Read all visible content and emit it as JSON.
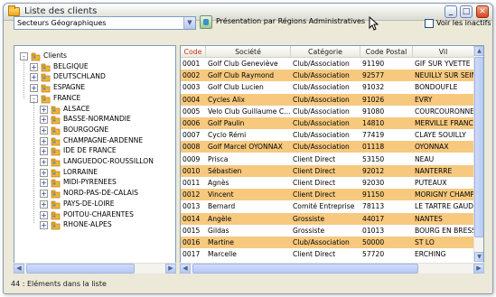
{
  "window": {
    "title": "Liste des clients",
    "minimize_icon": "minimize-icon",
    "maximize_icon": "maximize-icon",
    "close_icon": "close-icon"
  },
  "toolbar": {
    "sector_select_value": "Secteurs Géographiques",
    "region_button_label": "Présentation par Régions Administratives",
    "show_inactive_label": "Voir les inactifs",
    "show_inactive_checked": false
  },
  "tree": {
    "root": "Clients",
    "countries": [
      "BELGIQUE",
      "DEUTSCHLAND",
      "ESPAGNE",
      "FRANCE"
    ],
    "regions": [
      "ALSACE",
      "BASSE-NORMANDIE",
      "BOURGOGNE",
      "CHAMPAGNE-ARDENNE",
      "IDE DE FRANCE",
      "LANGUEDOC-ROUSSILLON",
      "LORRAINE",
      "MIDI-PYRENEES",
      "NORD-PAS-DE-CALAIS",
      "PAYS-DE-LOIRE",
      "POITOU-CHARENTES",
      "RHONE-ALPES"
    ]
  },
  "table": {
    "columns": [
      "Code",
      "Société",
      "Catégorie",
      "Code Postal",
      "Vil"
    ],
    "sorted_column": "Code",
    "highlight_color": "#f6c97f",
    "rows": [
      {
        "code": "0001",
        "societe": "Golf Club Geneviève",
        "categorie": "Club/Association",
        "cp": "91190",
        "ville": "GIF SUR YVETTE",
        "hl": false
      },
      {
        "code": "0002",
        "societe": "Golf Club Raymond",
        "categorie": "Club/Association",
        "cp": "92577",
        "ville": "NEUILLY SUR SEIN",
        "hl": true
      },
      {
        "code": "0003",
        "societe": "Golf Club Lucien",
        "categorie": "Club/Association",
        "cp": "91032",
        "ville": "BONDOUFLE",
        "hl": false
      },
      {
        "code": "0004",
        "societe": "Cycles Alix",
        "categorie": "Club/Association",
        "cp": "91026",
        "ville": "EVRY",
        "hl": true
      },
      {
        "code": "0005",
        "societe": "Velo Club Guillaume C...",
        "categorie": "Club/Association",
        "cp": "91080",
        "ville": "COURCOURONNES",
        "hl": false
      },
      {
        "code": "0006",
        "societe": "Golf Paulin",
        "categorie": "Club/Association",
        "cp": "14810",
        "ville": "MERVILLE FRANCE",
        "hl": true
      },
      {
        "code": "0007",
        "societe": "Cyclo Rémi",
        "categorie": "Club/Association",
        "cp": "77419",
        "ville": "CLAYE SOUILLY",
        "hl": false
      },
      {
        "code": "0008",
        "societe": "Golf Marcel OYONNAX",
        "categorie": "Club/Association",
        "cp": "01118",
        "ville": "OYONNAX",
        "hl": true
      },
      {
        "code": "0009",
        "societe": "Prisca",
        "categorie": "Client Direct",
        "cp": "53150",
        "ville": "NEAU",
        "hl": false
      },
      {
        "code": "0010",
        "societe": "Sébastien",
        "categorie": "Client Direct",
        "cp": "92012",
        "ville": "NANTERRE",
        "hl": true
      },
      {
        "code": "0011",
        "societe": "Agnès",
        "categorie": "Client Direct",
        "cp": "92030",
        "ville": "PUTEAUX",
        "hl": false
      },
      {
        "code": "0012",
        "societe": "Vincent",
        "categorie": "Client Direct",
        "cp": "91150",
        "ville": "MORIGNY CHAMPI",
        "hl": true
      },
      {
        "code": "0013",
        "societe": "Bernard",
        "categorie": "Comité Entreprise",
        "cp": "78113",
        "ville": "LE TARTRE GAUDR",
        "hl": false
      },
      {
        "code": "0014",
        "societe": "Angèle",
        "categorie": "Grossiste",
        "cp": "44017",
        "ville": "NANTES",
        "hl": true
      },
      {
        "code": "0015",
        "societe": "Gildas",
        "categorie": "Grossiste",
        "cp": "01013",
        "ville": "BOURG EN BRESSE",
        "hl": false
      },
      {
        "code": "0016",
        "societe": "Martine",
        "categorie": "Club/Association",
        "cp": "50000",
        "ville": "ST LO",
        "hl": true
      },
      {
        "code": "0017",
        "societe": "Marcelle",
        "categorie": "Client Direct",
        "cp": "57720",
        "ville": "ERCHING",
        "hl": false
      }
    ]
  },
  "status": {
    "text": "44 : Eléments dans la liste"
  }
}
